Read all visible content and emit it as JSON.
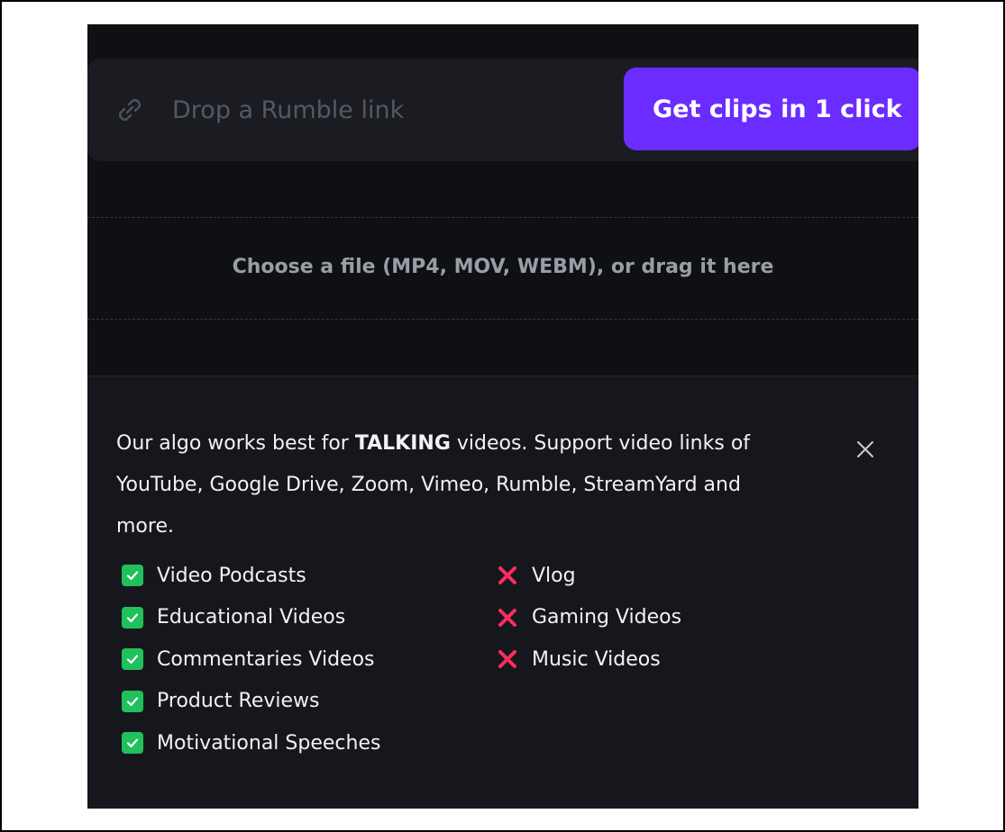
{
  "link_bar": {
    "placeholder": "Drop a Rumble link",
    "button_label": "Get clips in 1 click",
    "button_color": "#6b2cff"
  },
  "upload": {
    "text": "Choose a file (MP4, MOV, WEBM), or drag it here"
  },
  "info": {
    "text_prefix": "Our algo works best for ",
    "text_emphasis": "TALKING",
    "text_suffix": " videos. Support video links of YouTube, Google Drive, Zoom, Vimeo, Rumble, StreamYard and more.",
    "supported": [
      "Video Podcasts",
      "Educational Videos",
      "Commentaries Videos",
      "Product Reviews",
      "Motivational Speeches"
    ],
    "unsupported": [
      "Vlog",
      "Gaming Videos",
      "Music Videos"
    ],
    "check_color": "#20c05c",
    "cross_color": "#ff2d5e"
  },
  "icons": {
    "link": "link-icon",
    "close": "close-icon",
    "check": "check-icon",
    "cross": "cross-icon"
  }
}
